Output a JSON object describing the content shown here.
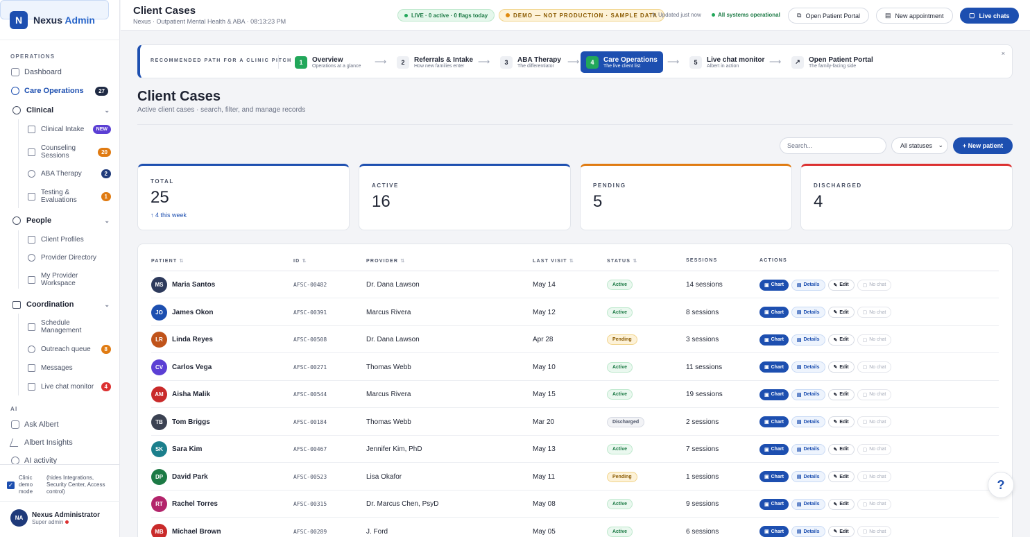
{
  "app": {
    "brand": "Nexus",
    "brand_accent": "Admin",
    "logo_letter": "N"
  },
  "sidebar": {
    "operations_label": "OPERATIONS",
    "dashboard": "Dashboard",
    "care_ops": "Care Operations",
    "care_ops_count": "27",
    "clinical": {
      "label": "Clinical",
      "items": [
        {
          "label": "Clinical Intake",
          "badge": "NEW"
        },
        {
          "label": "Counseling Sessions",
          "badge": "20"
        },
        {
          "label": "ABA Therapy",
          "badge": "2"
        },
        {
          "label": "Testing & Evaluations",
          "badge": "1"
        }
      ]
    },
    "people": {
      "label": "People",
      "items": [
        {
          "label": "Client Profiles"
        },
        {
          "label": "Provider Directory"
        },
        {
          "label": "My Provider Workspace"
        }
      ]
    },
    "coordination": {
      "label": "Coordination",
      "items": [
        {
          "label": "Schedule Management"
        },
        {
          "label": "Outreach queue",
          "badge": "8"
        },
        {
          "label": "Messages"
        },
        {
          "label": "Live chat monitor",
          "badge": "4"
        }
      ]
    },
    "ai_label": "AI",
    "ai_items": [
      "Ask Albert",
      "Albert Insights",
      "AI activity"
    ],
    "demo_mode": "Clinic demo mode",
    "demo_note": "(hides Integrations, Security Center, Access control)",
    "user_name": "Nexus Administrator",
    "user_role": "Super admin",
    "user_initials": "NA"
  },
  "topbar": {
    "title": "Client Cases",
    "subtitle": "Nexus · Outpatient Mental Health & ABA · 08:13:23 PM",
    "live": "LIVE · 0 active · 0 flags today",
    "demo": "DEMO — NOT PRODUCTION · SAMPLE DATA",
    "updated": "Updated just now",
    "systems": "All systems operational",
    "portal_btn": "Open Patient Portal",
    "appt_btn": "New appointment",
    "chat_btn": "Live chats"
  },
  "path": {
    "title": "RECOMMENDED PATH FOR A CLINIC PITCH",
    "steps": [
      {
        "num": "1",
        "title": "Overview",
        "sub": "Operations at a glance"
      },
      {
        "num": "2",
        "title": "Referrals & Intake",
        "sub": "How new families enter"
      },
      {
        "num": "3",
        "title": "ABA Therapy",
        "sub": "The differentiator"
      },
      {
        "num": "4",
        "title": "Care Operations",
        "sub": "The live client list"
      },
      {
        "num": "5",
        "title": "Live chat monitor",
        "sub": "Albert in action"
      },
      {
        "num": "↗",
        "title": "Open Patient Portal",
        "sub": "The family-facing side"
      }
    ],
    "close": "×"
  },
  "page": {
    "title": "Client Cases",
    "subtitle": "Active client cases · search, filter, and manage records",
    "search_placeholder": "Search...",
    "status_filter": "All statuses",
    "new_patient": "+ New patient"
  },
  "stats": [
    {
      "label": "TOTAL",
      "value": "25",
      "sub": "↑ 4 this week",
      "color": "#1d4fb0"
    },
    {
      "label": "ACTIVE",
      "value": "16",
      "sub": "",
      "color": "#1d4fb0"
    },
    {
      "label": "PENDING",
      "value": "5",
      "sub": "",
      "color": "#e07b12"
    },
    {
      "label": "DISCHARGED",
      "value": "4",
      "sub": "",
      "color": "#dc3030"
    }
  ],
  "table": {
    "headers": [
      "PATIENT",
      "ID",
      "PROVIDER",
      "LAST VISIT",
      "STATUS",
      "SESSIONS",
      "ACTIONS"
    ],
    "actions": {
      "chart": "Chart",
      "details": "Details",
      "edit": "Edit",
      "nochat": "No chat"
    },
    "rows": [
      {
        "initials": "MS",
        "name": "Maria Santos",
        "id": "AFSC-00482",
        "provider": "Dr. Dana Lawson",
        "visit": "May 14",
        "status": "Active",
        "sessions": "14 sessions",
        "color": "#2d3a5c"
      },
      {
        "initials": "JO",
        "name": "James Okon",
        "id": "AFSC-00391",
        "provider": "Marcus Rivera",
        "visit": "May 12",
        "status": "Active",
        "sessions": "8 sessions",
        "color": "#1d4fb0"
      },
      {
        "initials": "LR",
        "name": "Linda Reyes",
        "id": "AFSC-00508",
        "provider": "Dr. Dana Lawson",
        "visit": "Apr 28",
        "status": "Pending",
        "sessions": "3 sessions",
        "color": "#c0531a"
      },
      {
        "initials": "CV",
        "name": "Carlos Vega",
        "id": "AFSC-00271",
        "provider": "Thomas Webb",
        "visit": "May 10",
        "status": "Active",
        "sessions": "11 sessions",
        "color": "#5b3fd4"
      },
      {
        "initials": "AM",
        "name": "Aisha Malik",
        "id": "AFSC-00544",
        "provider": "Marcus Rivera",
        "visit": "May 15",
        "status": "Active",
        "sessions": "19 sessions",
        "color": "#c92a2a"
      },
      {
        "initials": "TB",
        "name": "Tom Briggs",
        "id": "AFSC-00184",
        "provider": "Thomas Webb",
        "visit": "Mar 20",
        "status": "Discharged",
        "sessions": "2 sessions",
        "color": "#3b4252"
      },
      {
        "initials": "SK",
        "name": "Sara Kim",
        "id": "AFSC-00467",
        "provider": "Jennifer Kim, PhD",
        "visit": "May 13",
        "status": "Active",
        "sessions": "7 sessions",
        "color": "#1b7f8c"
      },
      {
        "initials": "DP",
        "name": "David Park",
        "id": "AFSC-00523",
        "provider": "Lisa Okafor",
        "visit": "May 11",
        "status": "Pending",
        "sessions": "1 sessions",
        "color": "#1c7a45"
      },
      {
        "initials": "RT",
        "name": "Rachel Torres",
        "id": "AFSC-00315",
        "provider": "Dr. Marcus Chen, PsyD",
        "visit": "May 08",
        "status": "Active",
        "sessions": "9 sessions",
        "color": "#b3246b"
      },
      {
        "initials": "MB",
        "name": "Michael Brown",
        "id": "AFSC-00289",
        "provider": "J. Ford",
        "visit": "May 05",
        "status": "Active",
        "sessions": "6 sessions",
        "color": "#c92a2a"
      }
    ]
  },
  "help": "?"
}
